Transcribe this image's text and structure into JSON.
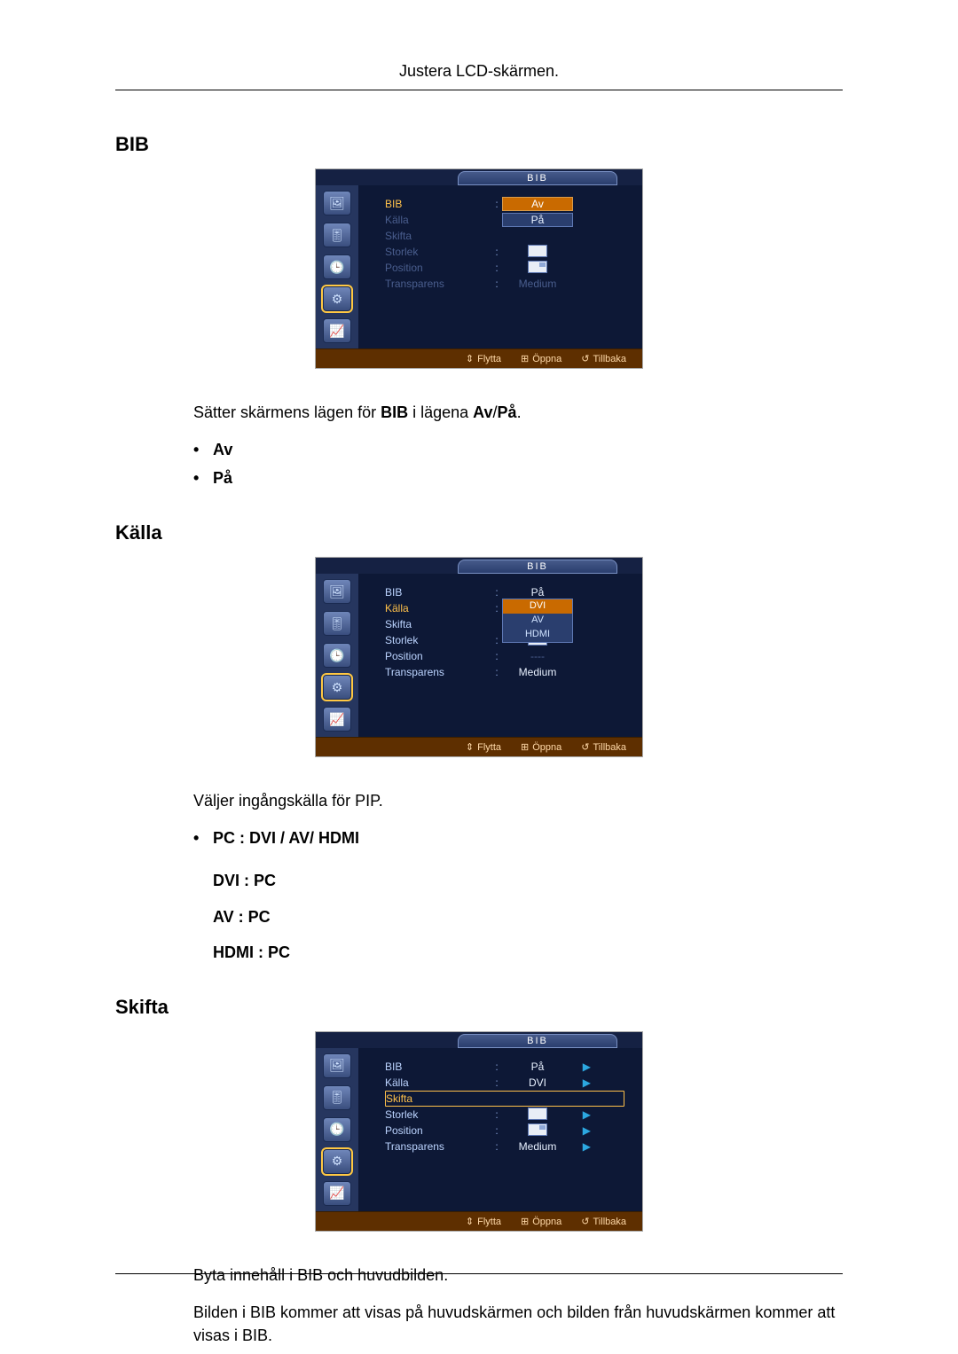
{
  "header": {
    "title": "Justera LCD-skärmen."
  },
  "sections": {
    "bib": {
      "title": "BIB",
      "osd": {
        "tab": "BIB",
        "rows": {
          "bib": {
            "label": "BIB",
            "value": "Av"
          },
          "kalla": {
            "label": "Källa",
            "value": "På"
          },
          "skifta": {
            "label": "Skifta",
            "value": ""
          },
          "storlek": {
            "label": "Storlek",
            "value": ""
          },
          "pos": {
            "label": "Position",
            "value": ""
          },
          "trans": {
            "label": "Transparens",
            "value": "Medium"
          }
        },
        "footer": {
          "move": "Flytta",
          "open": "Öppna",
          "back": "Tillbaka"
        }
      },
      "para": {
        "p1a": "Sätter skärmens lägen för ",
        "p1b": "BIB",
        "p1c": " i lägena ",
        "p1d": "Av",
        "p1e": "/",
        "p1f": "På",
        "p1g": "."
      },
      "opts": {
        "a": "Av",
        "b": "På"
      }
    },
    "kalla": {
      "title": "Källa",
      "osd": {
        "tab": "BIB",
        "rows": {
          "bib": {
            "label": "BIB",
            "value": "På"
          },
          "kalla": {
            "label": "Källa",
            "value": ""
          },
          "skifta": {
            "label": "Skifta",
            "value": ""
          },
          "storlek": {
            "label": "Storlek",
            "value": ""
          },
          "pos": {
            "label": "Position",
            "value": "----"
          },
          "trans": {
            "label": "Transparens",
            "value": "Medium"
          }
        },
        "dropdown": {
          "a": "DVI",
          "b": "AV",
          "c": "HDMI"
        },
        "footer": {
          "move": "Flytta",
          "open": "Öppna",
          "back": "Tillbaka"
        }
      },
      "para": {
        "p1": "Väljer ingångskälla för PIP."
      },
      "opts": {
        "head": "PC : DVI / AV/ HDMI",
        "a": "DVI : PC",
        "b": "AV : PC",
        "c": "HDMI : PC"
      }
    },
    "skifta": {
      "title": "Skifta",
      "osd": {
        "tab": "BIB",
        "rows": {
          "bib": {
            "label": "BIB",
            "value": "På"
          },
          "kalla": {
            "label": "Källa",
            "value": "DVI"
          },
          "skifta": {
            "label": "Skifta",
            "value": ""
          },
          "storlek": {
            "label": "Storlek",
            "value": ""
          },
          "pos": {
            "label": "Position",
            "value": ""
          },
          "trans": {
            "label": "Transparens",
            "value": "Medium"
          }
        },
        "footer": {
          "move": "Flytta",
          "open": "Öppna",
          "back": "Tillbaka"
        }
      },
      "para": {
        "p1": "Byta innehåll i BIB och huvudbilden.",
        "p2": "Bilden i BIB kommer att visas på huvudskärmen och bilden från huvudskärmen kommer att visas i BIB."
      }
    }
  }
}
